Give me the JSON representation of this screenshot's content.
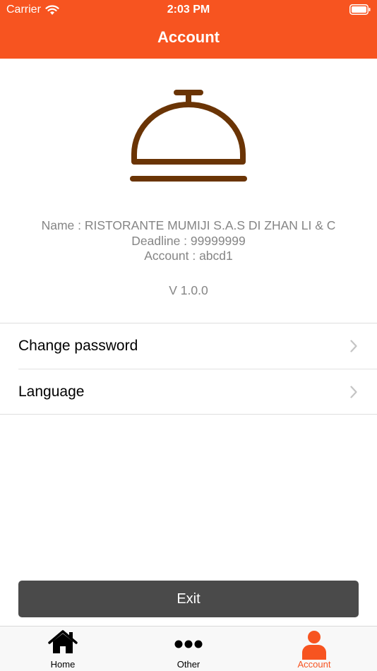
{
  "status_bar": {
    "carrier": "Carrier",
    "time": "2:03 PM"
  },
  "nav": {
    "title": "Account"
  },
  "logo": {
    "icon": "service-bell-icon",
    "color": "#6a3405"
  },
  "profile": {
    "name": "Name : RISTORANTE MUMIJI S.A.S DI ZHAN LI & C",
    "deadline": "Deadline : 99999999",
    "account": "Account : abcd1",
    "version": "V 1.0.0"
  },
  "menu": {
    "items": [
      {
        "label": "Change password",
        "icon": "chevron-right-icon"
      },
      {
        "label": "Language",
        "icon": "chevron-right-icon"
      }
    ]
  },
  "exit_button": {
    "label": "Exit"
  },
  "tab_bar": {
    "tabs": [
      {
        "label": "Home",
        "icon": "home-icon",
        "active": false
      },
      {
        "label": "Other",
        "icon": "more-icon",
        "active": false
      },
      {
        "label": "Account",
        "icon": "person-icon",
        "active": true
      }
    ]
  },
  "colors": {
    "accent": "#f75420",
    "button": "#4a4a4a",
    "muted_text": "#858585"
  }
}
